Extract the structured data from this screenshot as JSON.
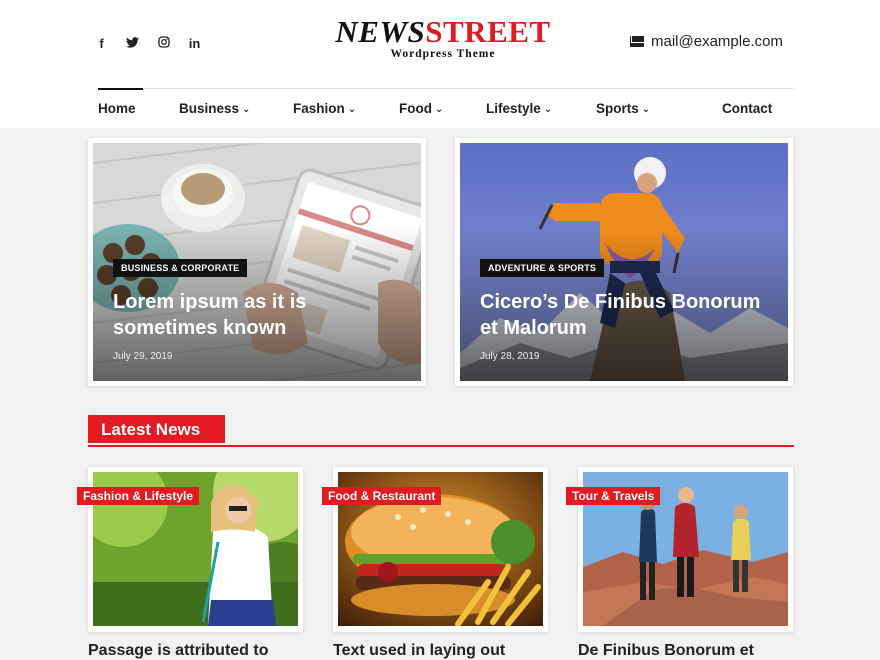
{
  "header": {
    "social": [
      "f",
      "𝕥",
      "◎",
      "in"
    ],
    "brand_news": "NEWS",
    "brand_street": "STREET",
    "tagline": "Wordpress Theme",
    "email": "mail@example.com"
  },
  "nav": {
    "items": [
      {
        "label": "Home",
        "chev": ""
      },
      {
        "label": "Business",
        "chev": "⌄"
      },
      {
        "label": "Fashion",
        "chev": "⌄"
      },
      {
        "label": "Food",
        "chev": "⌄"
      },
      {
        "label": "Lifestyle",
        "chev": "⌄"
      },
      {
        "label": "Sports",
        "chev": "⌄"
      },
      {
        "label": "Contact",
        "chev": ""
      }
    ]
  },
  "featured": [
    {
      "category": "BUSINESS & CORPORATE",
      "title": "Lorem ipsum as it is sometimes known",
      "date": "July 29, 2019"
    },
    {
      "category": "ADVENTURE & SPORTS",
      "title": "Cicero’s De Finibus Bonorum et Malorum",
      "date": "July 28, 2019"
    }
  ],
  "latest": {
    "heading": "Latest News",
    "posts": [
      {
        "category": "Fashion & Lifestyle",
        "title": "Passage is attributed to"
      },
      {
        "category": "Food & Restaurant",
        "title": "Text used in laying out"
      },
      {
        "category": "Tour & Travels",
        "title": "De Finibus Bonorum et"
      }
    ]
  },
  "colors": {
    "accent": "#e21b23",
    "dark": "#111111"
  }
}
